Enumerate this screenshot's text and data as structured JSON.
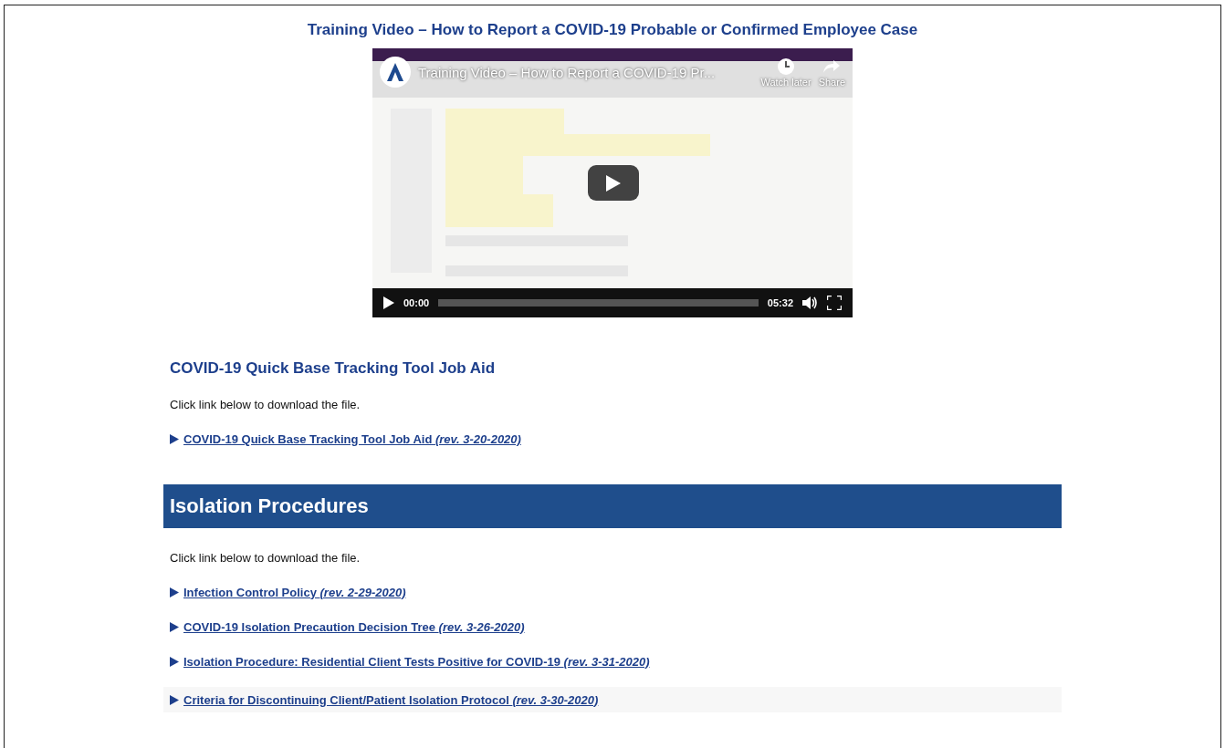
{
  "title": "Training Video – How to Report a COVID-19 Probable or Confirmed Employee Case",
  "video": {
    "overlay_title": "Training Video – How to Report a COVID-19 Pr...",
    "watch_later": "Watch later",
    "share": "Share",
    "time_current": "00:00",
    "time_total": "05:32"
  },
  "sections": [
    {
      "kind": "heading",
      "title": "COVID-19 Quick Base Tracking Tool Job Aid",
      "intro": "Click link below to download the file.",
      "links": [
        "COVID-19 Quick Base Tracking Tool Job Aid *(rev. 3-20-2020)*"
      ]
    },
    {
      "kind": "banner",
      "title": "Isolation Procedures",
      "intro": "Click link below to download the file.",
      "links": [
        "Infection Control Policy *(rev. 2-29-2020)*",
        "COVID-19 Isolation Precaution Decision Tree *(rev. 3-26-2020)*",
        "Isolation Procedure: Residential Client Tests Positive for COVID-19 *(rev. 3-31-2020)*",
        "Criteria for Discontinuing Client/Patient Isolation Protocol *(rev. 3-30-2020)*"
      ]
    }
  ]
}
